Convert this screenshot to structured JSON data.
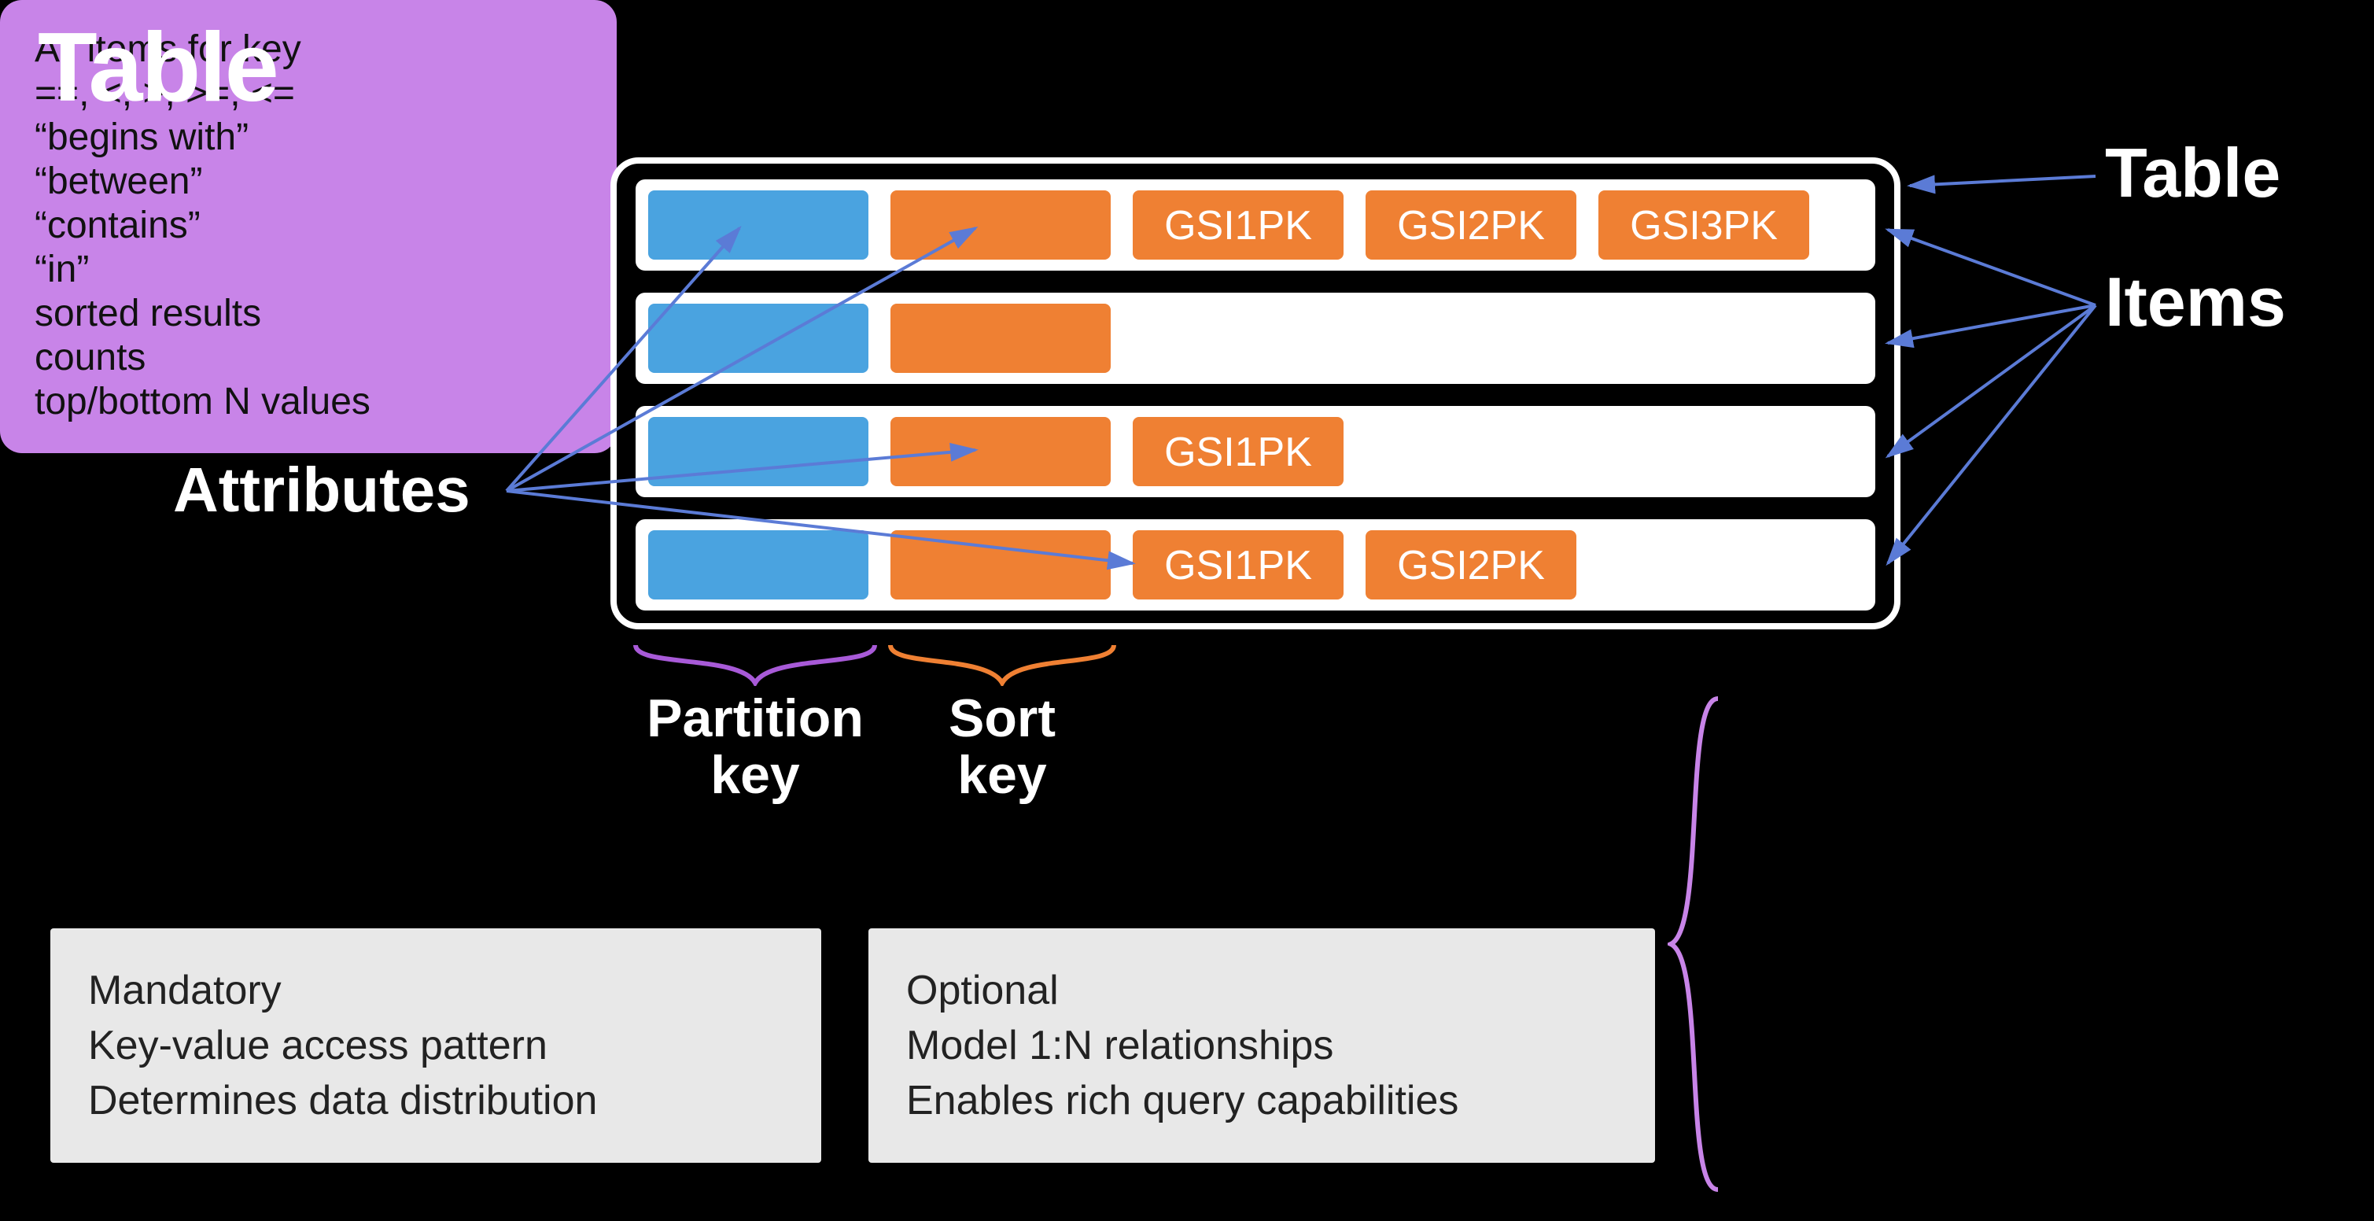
{
  "title": "Table",
  "labels": {
    "attributes": "Attributes",
    "table": "Table",
    "items": "Items",
    "partition_key": "Partition\nkey",
    "sort_key": "Sort\nkey"
  },
  "rows": [
    {
      "cells": [
        "",
        "",
        "GSI1PK",
        "GSI2PK",
        "GSI3PK"
      ]
    },
    {
      "cells": [
        "",
        ""
      ]
    },
    {
      "cells": [
        "",
        "",
        "GSI1PK"
      ]
    },
    {
      "cells": [
        "",
        "",
        "GSI1PK",
        "GSI2PK"
      ]
    }
  ],
  "info_left": [
    "Mandatory",
    "Key-value access pattern",
    "Determines data distribution"
  ],
  "info_mid": [
    "Optional",
    "Model 1:N relationships",
    "Enables rich query capabilities"
  ],
  "info_right": [
    "All items for key",
    "==, <, >, >=, <=",
    "“begins with”",
    "“between”",
    "“contains”",
    "“in”",
    "sorted results",
    "counts",
    "top/bottom N values"
  ],
  "colors": {
    "pk": "#4aa3e0",
    "sk_gsi": "#ef8033",
    "highlight_box": "#c884e8"
  }
}
